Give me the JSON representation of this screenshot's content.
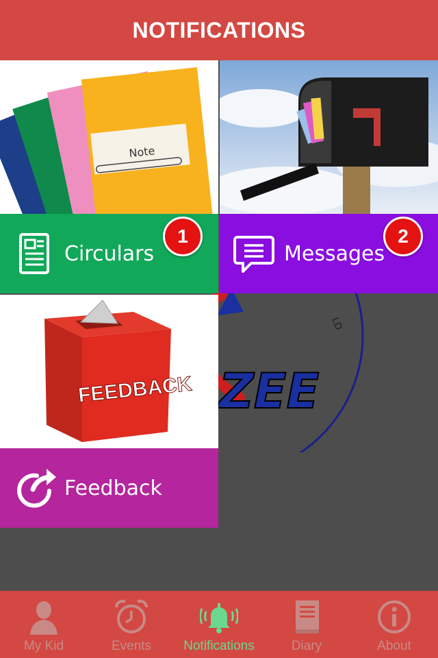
{
  "header": {
    "title": "NOTIFICATIONS"
  },
  "tiles": [
    {
      "id": "circulars",
      "label": "Circulars",
      "badge": "1",
      "icon": "document-icon",
      "image": "notebooks",
      "color": "#11a85a"
    },
    {
      "id": "messages",
      "label": "Messages",
      "badge": "2",
      "icon": "chat-bubble-icon",
      "image": "mailbox",
      "color": "#8a0ee0"
    },
    {
      "id": "feedback",
      "label": "Feedback",
      "badge": null,
      "icon": "share-arrow-icon",
      "image": "feedback-box",
      "color": "#b5259d"
    }
  ],
  "images": {
    "notebook_label": "Note",
    "feedback_box_text": "FEEDBACK",
    "watermark_text": "ZEE"
  },
  "tabbar": {
    "items": [
      {
        "label": "My Kid",
        "icon": "person-icon",
        "active": false
      },
      {
        "label": "Events",
        "icon": "alarm-clock-icon",
        "active": false
      },
      {
        "label": "Notifications",
        "icon": "bell-icon",
        "active": true
      },
      {
        "label": "Diary",
        "icon": "book-icon",
        "active": false
      },
      {
        "label": "About",
        "icon": "info-icon",
        "active": false
      }
    ]
  },
  "colors": {
    "header": "#d34843",
    "background": "#4d4d4d",
    "badge": "#e51212",
    "active_tab": "#6ad98f"
  }
}
